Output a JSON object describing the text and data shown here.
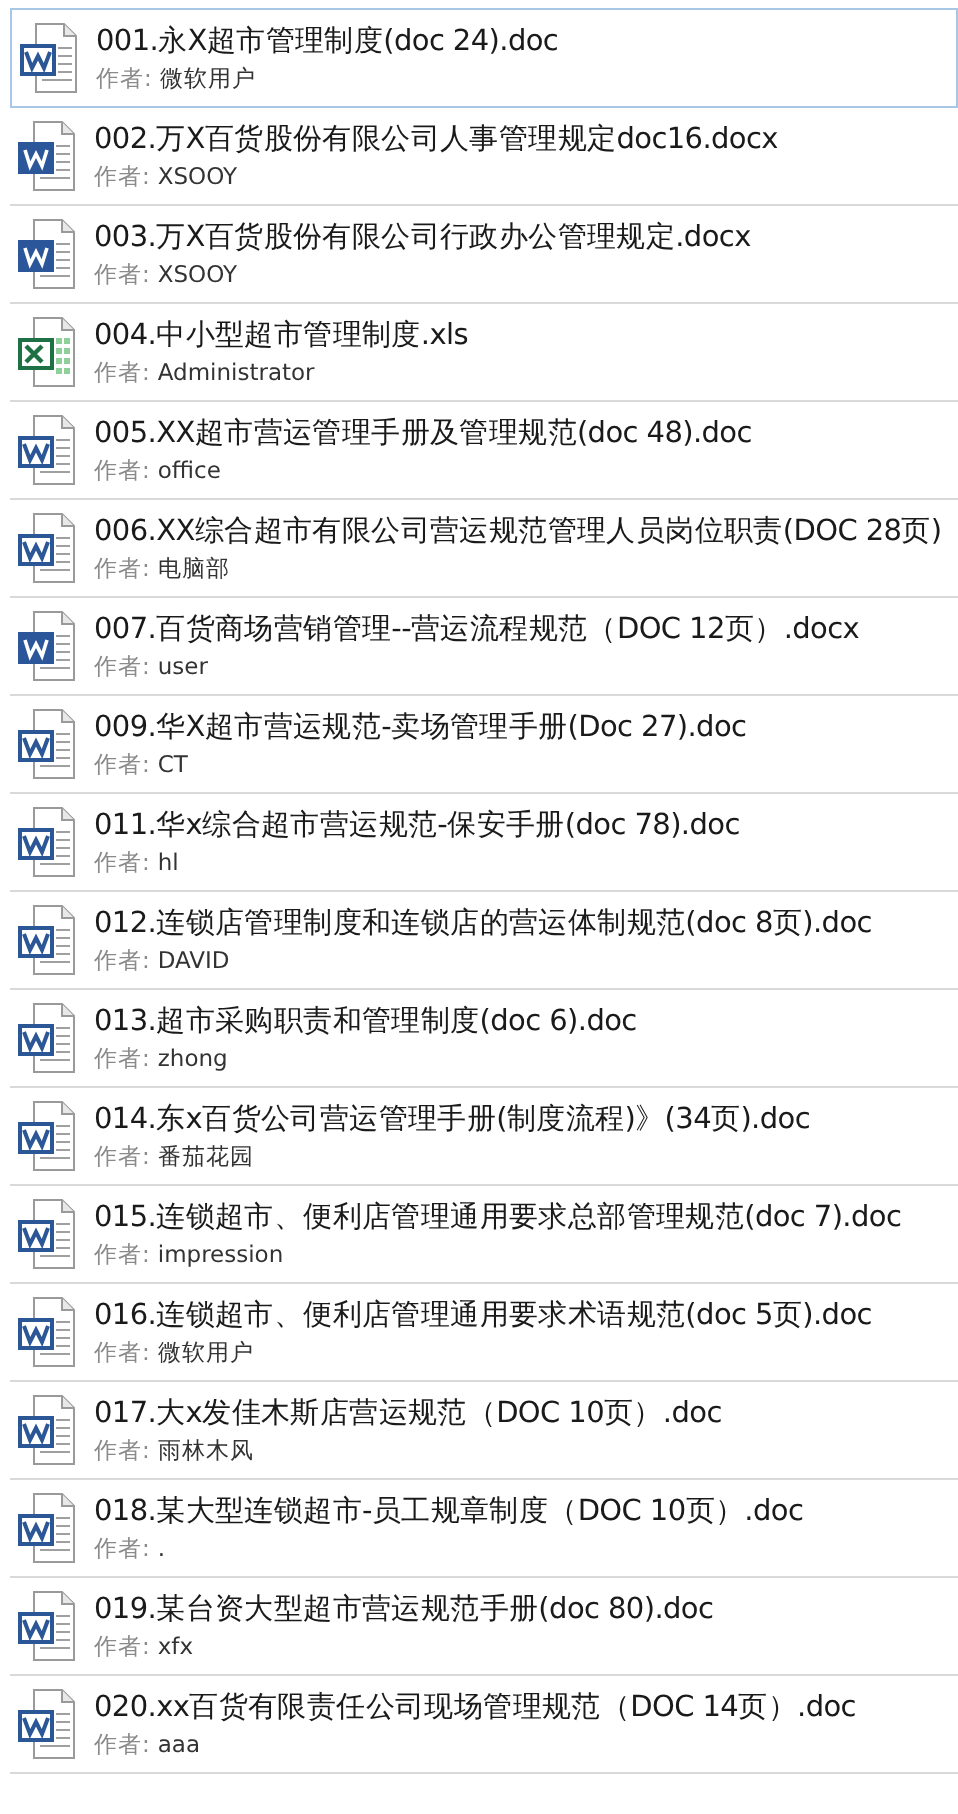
{
  "files": [
    {
      "title": "001.永X超市管理制度(doc 24).doc",
      "author_label": "作者:",
      "author": "微软用户",
      "kind": "doc",
      "selected": true
    },
    {
      "title": "002.万X百货股份有限公司人事管理规定doc16.docx",
      "author_label": "作者:",
      "author": "XSOOY",
      "kind": "docx",
      "selected": false
    },
    {
      "title": "003.万X百货股份有限公司行政办公管理规定.docx",
      "author_label": "作者:",
      "author": "XSOOY",
      "kind": "docx",
      "selected": false
    },
    {
      "title": "004.中小型超市管理制度.xls",
      "author_label": "作者:",
      "author": "Administrator",
      "kind": "xls",
      "selected": false
    },
    {
      "title": "005.XX超市营运管理手册及管理规范(doc 48).doc",
      "author_label": "作者:",
      "author": "office",
      "kind": "doc",
      "selected": false
    },
    {
      "title": "006.XX综合超市有限公司营运规范管理人员岗位职责(DOC 28页)",
      "author_label": "作者:",
      "author": "电脑部",
      "kind": "doc",
      "selected": false
    },
    {
      "title": "007.百货商场营销管理--营运流程规范（DOC 12页）.docx",
      "author_label": "作者:",
      "author": "user",
      "kind": "docx",
      "selected": false
    },
    {
      "title": "009.华X超市营运规范-卖场管理手册(Doc 27).doc",
      "author_label": "作者:",
      "author": "CT",
      "kind": "doc",
      "selected": false
    },
    {
      "title": "011.华x综合超市营运规范-保安手册(doc 78).doc",
      "author_label": "作者:",
      "author": "hl",
      "kind": "doc",
      "selected": false
    },
    {
      "title": "012.连锁店管理制度和连锁店的营运体制规范(doc 8页).doc",
      "author_label": "作者:",
      "author": "DAVID",
      "kind": "doc",
      "selected": false
    },
    {
      "title": "013.超市采购职责和管理制度(doc 6).doc",
      "author_label": "作者:",
      "author": "zhong",
      "kind": "doc",
      "selected": false
    },
    {
      "title": "014.东x百货公司营运管理手册(制度流程)》(34页).doc",
      "author_label": "作者:",
      "author": "番茄花园",
      "kind": "doc",
      "selected": false
    },
    {
      "title": "015.连锁超市、便利店管理通用要求总部管理规范(doc 7).doc",
      "author_label": "作者:",
      "author": "impression",
      "kind": "doc",
      "selected": false
    },
    {
      "title": "016.连锁超市、便利店管理通用要求术语规范(doc 5页).doc",
      "author_label": "作者:",
      "author": "微软用户",
      "kind": "doc",
      "selected": false
    },
    {
      "title": "017.大x发佳木斯店营运规范（DOC 10页）.doc",
      "author_label": "作者:",
      "author": "雨林木风",
      "kind": "doc",
      "selected": false
    },
    {
      "title": "018.某大型连锁超市-员工规章制度（DOC 10页）.doc",
      "author_label": "作者:",
      "author": ".",
      "kind": "doc",
      "selected": false
    },
    {
      "title": "019.某台资大型超市营运规范手册(doc 80).doc",
      "author_label": "作者:",
      "author": "xfx",
      "kind": "doc",
      "selected": false
    },
    {
      "title": "020.xx百货有限责任公司现场管理规范（DOC 14页）.doc",
      "author_label": "作者:",
      "author": "aaa",
      "kind": "doc",
      "selected": false
    }
  ]
}
